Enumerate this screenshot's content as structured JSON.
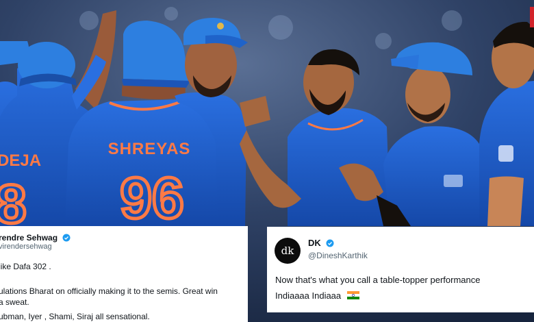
{
  "photo": {
    "jersey_name": "SHREYAS",
    "jersey_number": "96",
    "left_jersey_name_fragment": "DEJA",
    "left_jersey_number_fragment": "8",
    "colors": {
      "jersey_blue": "#1f5fcf",
      "jersey_orange": "#ff7a45",
      "cap_blue": "#2d7fe0"
    }
  },
  "tweet_left": {
    "name": "rendre Sehwag",
    "handle": "virendersehwag",
    "lines": [
      "like Dafa 302 .",
      "",
      "ulations Bharat on officially making it to the semis. Great win",
      "a sweat.",
      "ubman, Iyer , Shami, Siraj all sensational."
    ]
  },
  "tweet_right": {
    "avatar_text": "dk",
    "name": "DK",
    "handle": "@DineshKarthik",
    "line1": "Now that's what you call a table-topper performance",
    "line2": "Indiaaaa Indiaaa"
  },
  "icons": {
    "verified": "verified-badge-icon",
    "flag": "india-flag-icon"
  }
}
